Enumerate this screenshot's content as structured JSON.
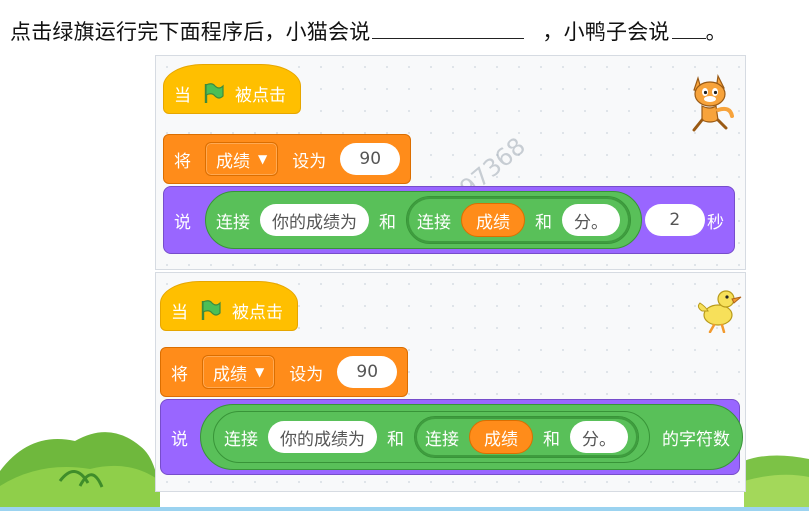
{
  "question": {
    "part1": "点击绿旗运行完下面程序后，小猫会说",
    "part2": "，小鸭子会说",
    "end": "。"
  },
  "watermark": "14597368",
  "program1": {
    "sprite_icon": "cat-sprite-icon",
    "hat": {
      "when": "当",
      "after": "被点击"
    },
    "set": {
      "label": "将",
      "variable": "成绩",
      "to": "设为",
      "value": "90"
    },
    "say": {
      "label": "说",
      "join_label": "连接",
      "str1": "你的成绩为",
      "and": "和",
      "inner_join_label": "连接",
      "inner_var": "成绩",
      "inner_and": "和",
      "str2": "分。",
      "secs": "2",
      "secs_unit": "秒"
    }
  },
  "program2": {
    "sprite_icon": "duck-sprite-icon",
    "hat": {
      "when": "当",
      "after": "被点击"
    },
    "set": {
      "label": "将",
      "variable": "成绩",
      "to": "设为",
      "value": "90"
    },
    "say": {
      "label": "说",
      "join_label": "连接",
      "str1": "你的成绩为",
      "and": "和",
      "inner_join_label": "连接",
      "inner_var": "成绩",
      "inner_and": "和",
      "str2": "分。",
      "op_suffix": "的字符数"
    }
  },
  "colors": {
    "events": "#ffbf00",
    "variables": "#ff8c1a",
    "looks": "#9966ff",
    "operators": "#59c059",
    "flag": "#4cbf56"
  }
}
